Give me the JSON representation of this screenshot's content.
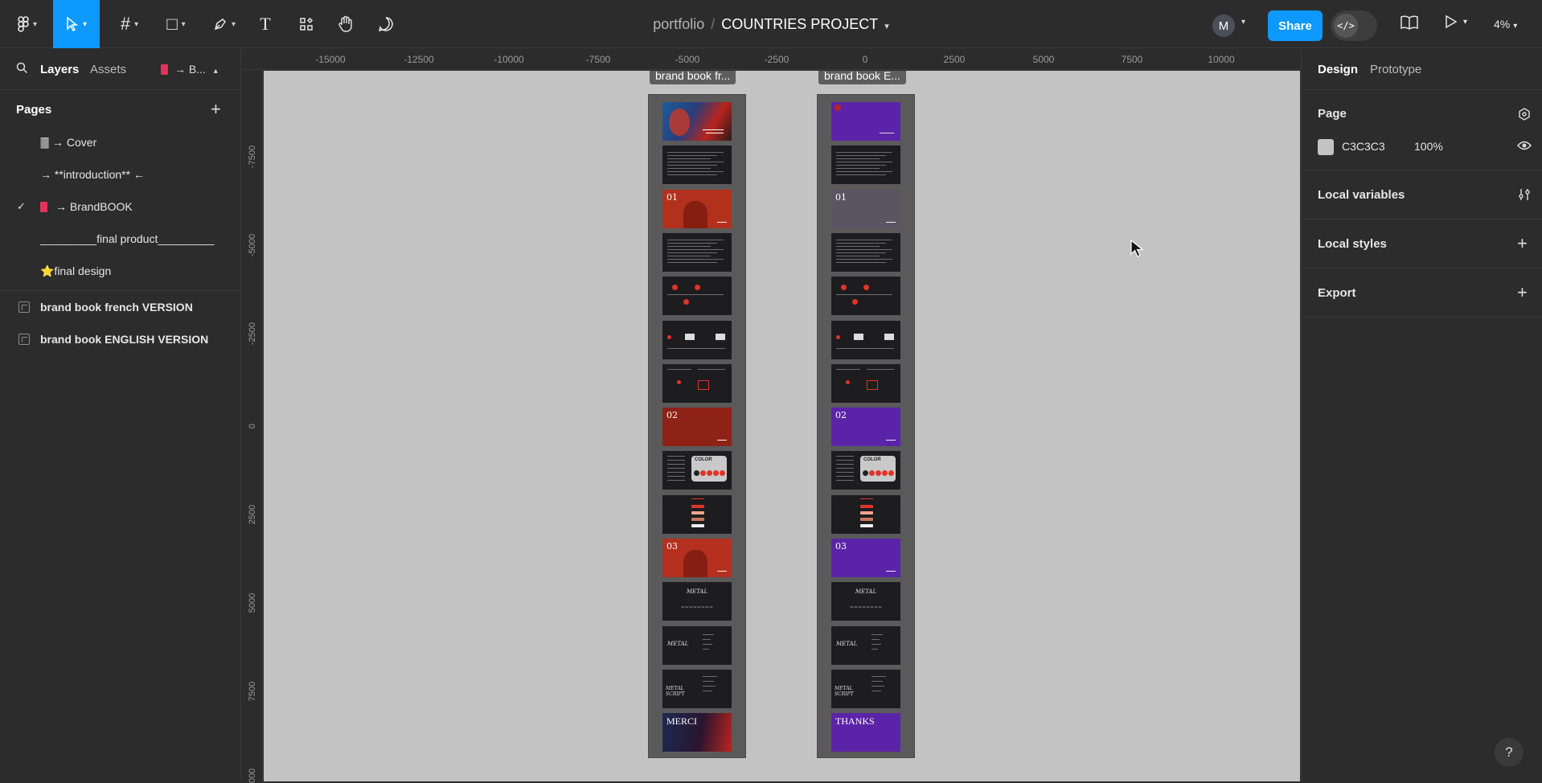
{
  "toolbar": {
    "main_menu_icon": "figma-logo-icon",
    "move_tool": "move-tool",
    "frame_tool": "#",
    "shape_tool": "□",
    "pen_tool": "pen-icon",
    "text_tool": "T",
    "resources_tool": "resources-icon",
    "hand_tool": "hand-icon",
    "comment_tool": "comment-icon"
  },
  "header": {
    "project": "portfolio",
    "separator": "/",
    "file_name": "COUNTRIES PROJECT",
    "avatar_initial": "M",
    "share_label": "Share",
    "dev_mode_label": "</>",
    "zoom": "4%"
  },
  "left_panel": {
    "tabs": {
      "layers": "Layers",
      "assets": "Assets",
      "page_picker": "→ B..."
    },
    "pages_title": "Pages",
    "pages": [
      {
        "label": "🀫 → Cover",
        "selected": false
      },
      {
        "label": "→ **introduction** ←",
        "selected": false
      },
      {
        "label": "→ BrandBOOK",
        "selected": true,
        "has_book": true
      },
      {
        "label": "_________final product_________",
        "selected": false
      },
      {
        "label": "⭐final design",
        "selected": false
      }
    ],
    "layers": [
      {
        "label": "brand book french VERSION"
      },
      {
        "label": "brand book ENGLISH VERSION"
      }
    ]
  },
  "rulers": {
    "top": [
      "-15000",
      "-12500",
      "-10000",
      "-7500",
      "-5000",
      "-2500",
      "0",
      "2500",
      "5000",
      "7500",
      "10000"
    ],
    "left": [
      "-7500",
      "-5000",
      "-2500",
      "0",
      "2500",
      "5000",
      "7500",
      "000"
    ]
  },
  "canvas": {
    "background": "#C3C3C3",
    "frames": [
      {
        "label": "brand book fr...",
        "slides": [
          {
            "kind": "cover-red"
          },
          {
            "kind": "text-dense"
          },
          {
            "kind": "chapter",
            "num": "01",
            "bg": "#b2311c"
          },
          {
            "kind": "text-dense"
          },
          {
            "kind": "red-diagram"
          },
          {
            "kind": "red-diagram2"
          },
          {
            "kind": "red-diagram3"
          },
          {
            "kind": "chapter",
            "num": "02",
            "bg": "#8e2217"
          },
          {
            "kind": "color",
            "label": "COLOR"
          },
          {
            "kind": "bars"
          },
          {
            "kind": "chapter",
            "num": "03",
            "bg": "#b5301f"
          },
          {
            "kind": "script",
            "text": "METAL"
          },
          {
            "kind": "script2",
            "text": "METAL"
          },
          {
            "kind": "script3",
            "text": "METAL SCRIPT"
          },
          {
            "kind": "end",
            "text": "MERCI",
            "bg": "#1c2a52"
          }
        ]
      },
      {
        "label": "brand book E...",
        "slides": [
          {
            "kind": "cover-purple"
          },
          {
            "kind": "text-dense"
          },
          {
            "kind": "chapter",
            "num": "01",
            "bg": "#5b5563"
          },
          {
            "kind": "text-dense"
          },
          {
            "kind": "red-diagram"
          },
          {
            "kind": "red-diagram2"
          },
          {
            "kind": "red-diagram3"
          },
          {
            "kind": "chapter",
            "num": "02",
            "bg": "#5b24a8"
          },
          {
            "kind": "color",
            "label": "COLOR"
          },
          {
            "kind": "bars"
          },
          {
            "kind": "chapter",
            "num": "03",
            "bg": "#5b24a8"
          },
          {
            "kind": "script",
            "text": "METAL"
          },
          {
            "kind": "script2",
            "text": "METAL"
          },
          {
            "kind": "script3",
            "text": "METAL SCRIPT"
          },
          {
            "kind": "end",
            "text": "THANKS",
            "bg": "#5b24a8"
          }
        ]
      }
    ]
  },
  "right_panel": {
    "tabs": {
      "design": "Design",
      "prototype": "Prototype"
    },
    "page_section": "Page",
    "page_color": "C3C3C3",
    "page_opacity": "100%",
    "local_variables": "Local variables",
    "local_styles": "Local styles",
    "export": "Export"
  },
  "help_label": "?"
}
